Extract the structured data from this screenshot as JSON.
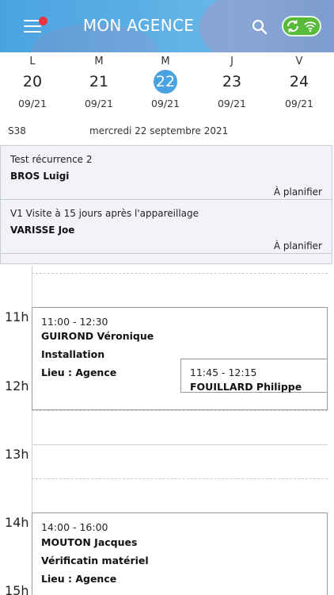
{
  "header": {
    "title": "MON AGENCE",
    "menu_icon": "hamburger-icon",
    "search_icon": "search-icon",
    "sync_icon": "sync-wifi-icon",
    "accent": "#4aa3e0",
    "notification_color": "#ee3340",
    "sync_color": "#58b93a"
  },
  "week": {
    "days": [
      {
        "letter": "L",
        "num": "20",
        "month": "09/21"
      },
      {
        "letter": "M",
        "num": "21",
        "month": "09/21"
      },
      {
        "letter": "M",
        "num": "22",
        "month": "09/21"
      },
      {
        "letter": "J",
        "num": "23",
        "month": "09/21"
      },
      {
        "letter": "V",
        "num": "24",
        "month": "09/21"
      }
    ],
    "selected_index": 2,
    "week_label": "S38",
    "full_date": "mercredi 22 septembre 2021"
  },
  "pending": [
    {
      "title": "Test récurrence 2",
      "name": "BROS Luigi",
      "status": "À planifier"
    },
    {
      "title": "V1 Visite à 15 jours après l'appareillage",
      "name": "VARISSE Joe",
      "status": "À planifier"
    }
  ],
  "calendar": {
    "hours": [
      "11h",
      "12h",
      "13h",
      "14h",
      "15h"
    ],
    "appointments": [
      {
        "time": "11:00 - 12:30",
        "name": "GUIROND Véronique",
        "type": "Installation",
        "place": "Lieu : Agence"
      },
      {
        "time": "11:45 - 12:15",
        "name": "FOUILLARD Philippe"
      },
      {
        "time": "14:00 - 16:00",
        "name": "MOUTON Jacques",
        "type": "Vérificatin matériel",
        "place": "Lieu : Agence"
      }
    ]
  }
}
